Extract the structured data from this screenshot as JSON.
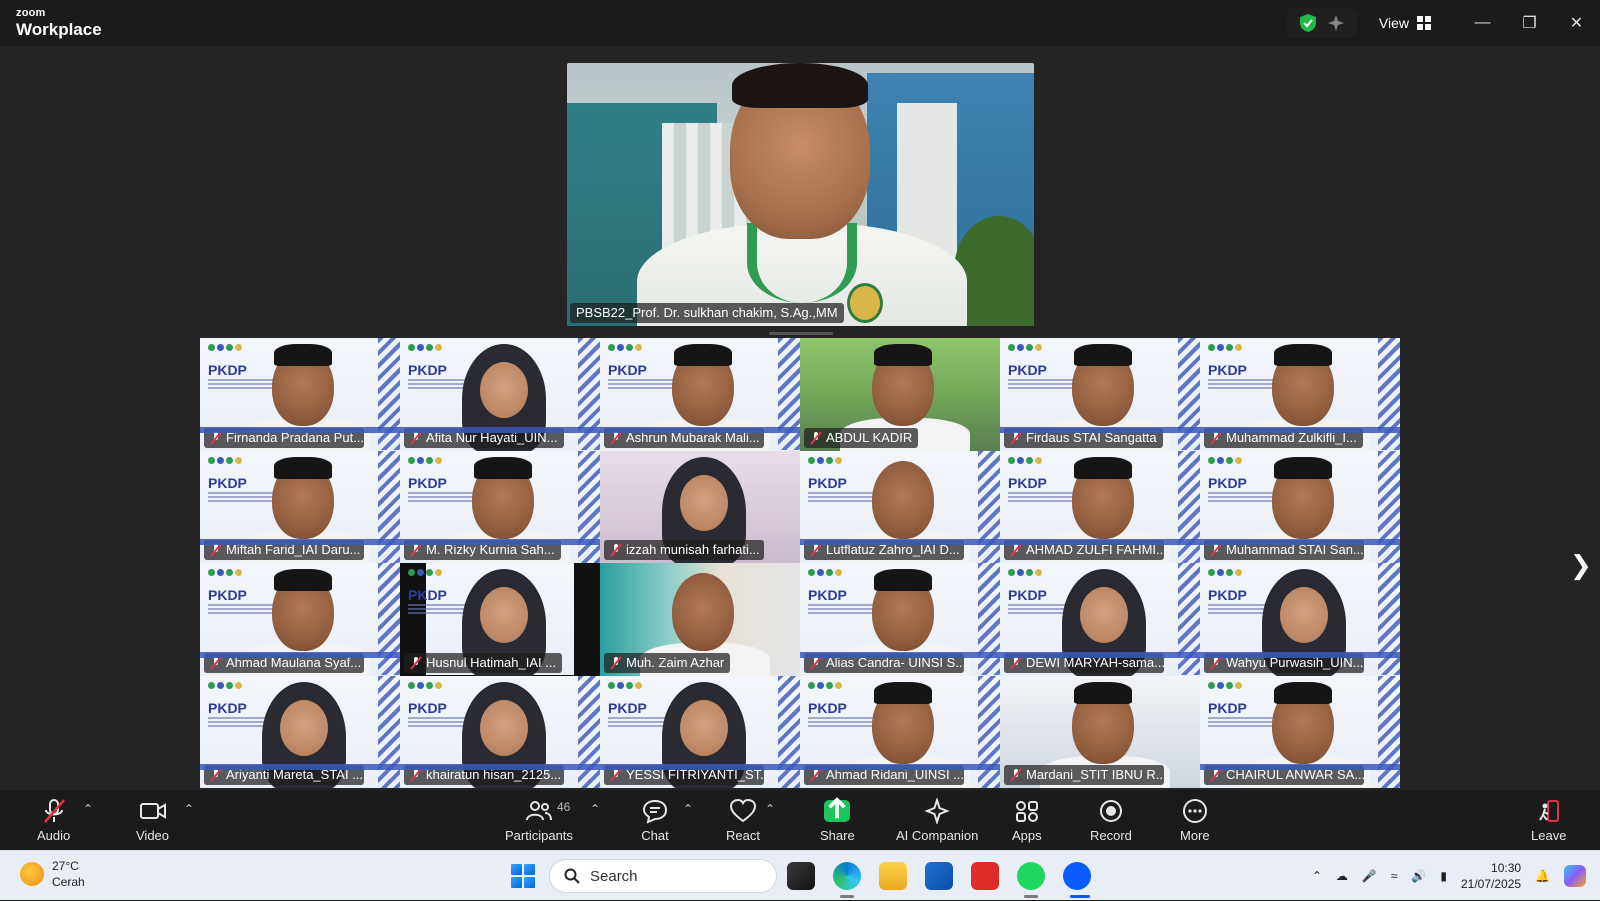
{
  "app": {
    "brand_small": "zoom",
    "brand_big": "Workplace",
    "view_label": "View"
  },
  "speaker": {
    "name": "PBSB22_Prof. Dr. sulkhan chakim, S.Ag.,MM"
  },
  "participants": [
    {
      "name": "Firnanda Pradana Put...",
      "style": "pkdp",
      "avatar": "cap"
    },
    {
      "name": "Afita Nur Hayati_UIN...",
      "style": "pkdp",
      "avatar": "hijab"
    },
    {
      "name": "Ashrun Mubarak Mali...",
      "style": "pkdp",
      "avatar": "cap"
    },
    {
      "name": "ABDUL KADIR",
      "style": "camera1",
      "avatar": "cap"
    },
    {
      "name": "Firdaus STAI Sangatta",
      "style": "pkdp",
      "avatar": "cap"
    },
    {
      "name": "Muhammad Zulkifli_I...",
      "style": "pkdp",
      "avatar": "cap"
    },
    {
      "name": "Miftah Farid_IAI Daru...",
      "style": "pkdp",
      "avatar": "cap"
    },
    {
      "name": "M. Rizky Kurnia Sah...",
      "style": "pkdp",
      "avatar": "cap"
    },
    {
      "name": "izzah munisah farhati...",
      "style": "camera2",
      "avatar": "hijab"
    },
    {
      "name": "Lutflatuz Zahro_IAI D...",
      "style": "pkdp",
      "avatar": "plain"
    },
    {
      "name": "AHMAD ZULFI FAHMI...",
      "style": "pkdp",
      "avatar": "cap"
    },
    {
      "name": "Muhammad STAI San...",
      "style": "pkdp",
      "avatar": "cap"
    },
    {
      "name": "Ahmad Maulana Syaf...",
      "style": "pkdp",
      "avatar": "cap"
    },
    {
      "name": "Husnul Hatimah_IAI ...",
      "style": "black-sides",
      "avatar": "hijab"
    },
    {
      "name": "Muh. Zaim Azhar",
      "style": "camera3",
      "avatar": "plain"
    },
    {
      "name": "Alias Candra- UINSI S...",
      "style": "pkdp",
      "avatar": "cap"
    },
    {
      "name": "DEWI MARYAH-sama...",
      "style": "pkdp",
      "avatar": "hijab"
    },
    {
      "name": "Wahyu Purwasih_UIN...",
      "style": "pkdp",
      "avatar": "hijab"
    },
    {
      "name": "Ariyanti Mareta_STAI ...",
      "style": "pkdp",
      "avatar": "hijab"
    },
    {
      "name": "khairatun hisan_2125...",
      "style": "pkdp",
      "avatar": "hijab"
    },
    {
      "name": "YESSI FITRIYANTI_ST...",
      "style": "pkdp",
      "avatar": "hijab"
    },
    {
      "name": "Ahmad Ridani_UINSI ...",
      "style": "pkdp",
      "avatar": "cap"
    },
    {
      "name": "Mardani_STIT IBNU R...",
      "style": "camera6",
      "avatar": "cap"
    },
    {
      "name": "CHAIRUL ANWAR SA...",
      "style": "pkdp",
      "avatar": "cap"
    }
  ],
  "pkdp_label": "PKDP",
  "toolbar": {
    "audio": "Audio",
    "video": "Video",
    "participants": "Participants",
    "participants_count": "46",
    "chat": "Chat",
    "react": "React",
    "share": "Share",
    "ai": "AI Companion",
    "apps": "Apps",
    "record": "Record",
    "more": "More",
    "leave": "Leave"
  },
  "taskbar": {
    "temp": "27°C",
    "weather": "Cerah",
    "search": "Search",
    "time": "10:30",
    "date": "21/07/2025"
  },
  "colors": {
    "accent_green": "#1fc35b",
    "leave_red": "#e0344a",
    "shield_green": "#21b94a"
  }
}
